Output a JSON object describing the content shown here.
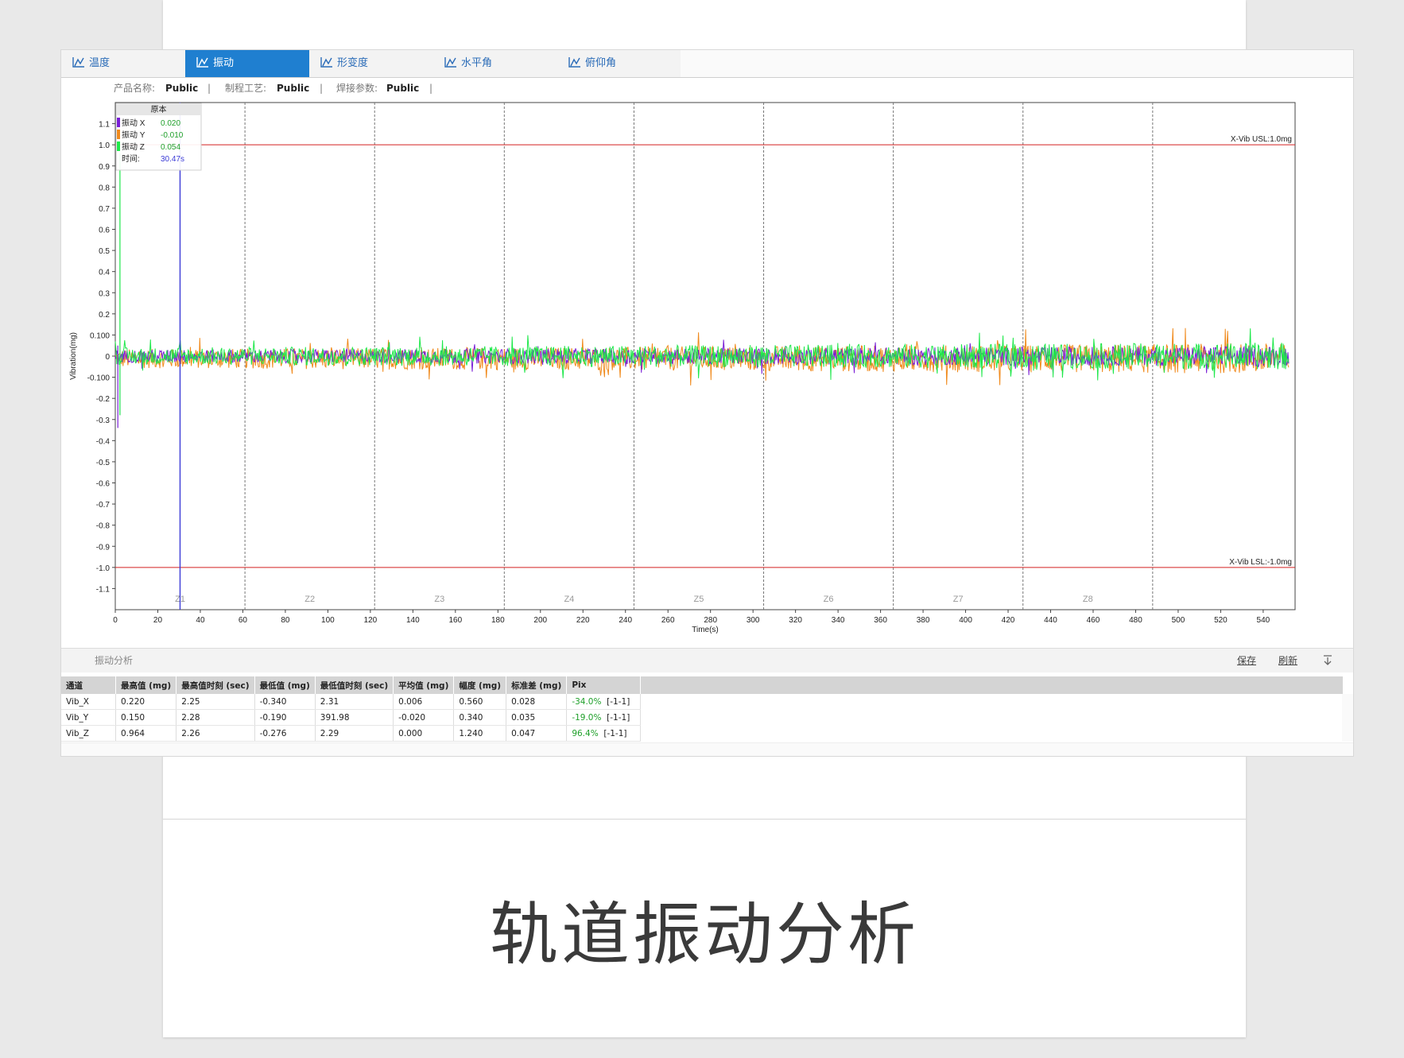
{
  "tabs": [
    {
      "label": "温度",
      "active": false
    },
    {
      "label": "振动",
      "active": true
    },
    {
      "label": "形变度",
      "active": false
    },
    {
      "label": "水平角",
      "active": false
    },
    {
      "label": "俯仰角",
      "active": false
    }
  ],
  "info": {
    "product_label": "产品名称:",
    "product_value": "Public",
    "process_label": "制程工艺:",
    "process_value": "Public",
    "weld_label": "焊接参数:",
    "weld_value": "Public",
    "separator": "|"
  },
  "chart_data": {
    "type": "line",
    "xlabel": "Time(s)",
    "ylabel": "Vibration(mg)",
    "xlim": [
      0,
      555
    ],
    "ylim": [
      -1.2,
      1.2
    ],
    "x_ticks": [
      0,
      20,
      40,
      60,
      80,
      100,
      120,
      140,
      160,
      180,
      200,
      220,
      240,
      260,
      280,
      300,
      320,
      340,
      360,
      380,
      400,
      420,
      440,
      460,
      480,
      500,
      520,
      540
    ],
    "y_ticks": [
      1.1,
      1.0,
      0.9,
      0.8,
      0.7,
      0.6,
      0.5,
      0.4,
      0.3,
      0.2,
      0.1,
      0,
      -0.1,
      -0.2,
      -0.3,
      -0.4,
      -0.5,
      -0.6,
      -0.7,
      -0.8,
      -0.9,
      -1.0,
      -1.1
    ],
    "y_tick_labels": [
      "1.1",
      "1.0",
      "0.9",
      "0.8",
      "0.7",
      "0.6",
      "0.5",
      "0.4",
      "0.3",
      "0.2",
      "0.100",
      "0",
      "-0.100",
      "-0.2",
      "-0.3",
      "-0.4",
      "-0.5",
      "-0.6",
      "-0.7",
      "-0.8",
      "-0.9",
      "-1.0",
      "-1.1"
    ],
    "limits": [
      {
        "label": "X-Vib USL:1.0mg",
        "value": 1.0,
        "color": "#d42020"
      },
      {
        "label": "X-Vib LSL:-1.0mg",
        "value": -1.0,
        "color": "#d42020"
      }
    ],
    "zones": [
      {
        "label": "Z1",
        "start": 0,
        "end": 61
      },
      {
        "label": "Z2",
        "start": 61,
        "end": 122
      },
      {
        "label": "Z3",
        "start": 122,
        "end": 183
      },
      {
        "label": "Z4",
        "start": 183,
        "end": 244
      },
      {
        "label": "Z5",
        "start": 244,
        "end": 305
      },
      {
        "label": "Z6",
        "start": 305,
        "end": 366
      },
      {
        "label": "Z7",
        "start": 366,
        "end": 427
      },
      {
        "label": "Z8",
        "start": 427,
        "end": 488
      }
    ],
    "cursor_x": 30.47,
    "series": [
      {
        "name": "振动 X",
        "color": "#7a1fd6",
        "amplitude": 0.03
      },
      {
        "name": "振动 Y",
        "color": "#f08a1c",
        "amplitude": 0.045
      },
      {
        "name": "振动 Z",
        "color": "#1ee84a",
        "amplitude": 0.04
      }
    ],
    "tooltip": {
      "title": "原本",
      "rows": [
        {
          "label": "振动 X",
          "value": "0.020",
          "color": "#7a1fd6"
        },
        {
          "label": "振动 Y",
          "value": "-0.010",
          "color": "#f08a1c"
        },
        {
          "label": "振动 Z",
          "value": "0.054",
          "color": "#1ee84a"
        },
        {
          "label": "时间:",
          "value": "30.47s",
          "color": ""
        }
      ]
    }
  },
  "analysis": {
    "title": "振动分析",
    "save_label": "保存",
    "refresh_label": "刷新",
    "columns": [
      "通道",
      "最高值 (mg)",
      "最高值时刻 (sec)",
      "最低值 (mg)",
      "最低值时刻 (sec)",
      "平均值 (mg)",
      "幅度 (mg)",
      "标准差 (mg)",
      "Pix"
    ],
    "rows": [
      [
        "Vib_X",
        "0.220",
        "2.25",
        "-0.340",
        "2.31",
        "0.006",
        "0.560",
        "0.028",
        "-34.0%",
        "[-1-1]"
      ],
      [
        "Vib_Y",
        "0.150",
        "2.28",
        "-0.190",
        "391.98",
        "-0.020",
        "0.340",
        "0.035",
        "-19.0%",
        "[-1-1]"
      ],
      [
        "Vib_Z",
        "0.964",
        "2.26",
        "-0.276",
        "2.29",
        "0.000",
        "1.240",
        "0.047",
        "96.4%",
        "[-1-1]"
      ]
    ]
  },
  "caption": "轨道振动分析",
  "colors": {
    "accent": "#1f7fd0",
    "limit": "#d42020",
    "cursor": "#3b3bd6"
  }
}
